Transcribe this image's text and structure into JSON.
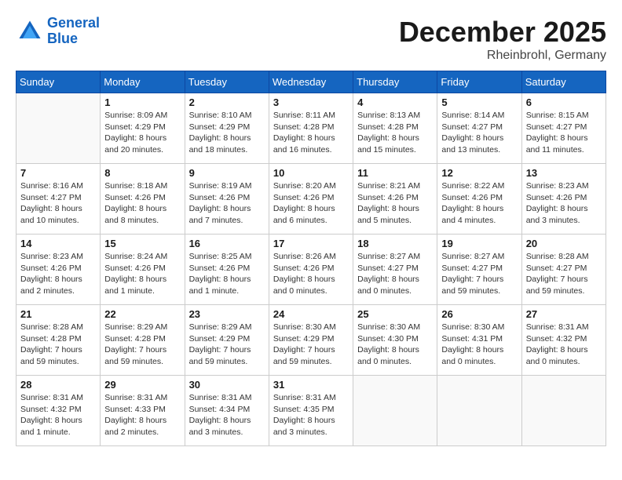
{
  "header": {
    "logo_line1": "General",
    "logo_line2": "Blue",
    "month": "December 2025",
    "location": "Rheinbrohl, Germany"
  },
  "weekdays": [
    "Sunday",
    "Monday",
    "Tuesday",
    "Wednesday",
    "Thursday",
    "Friday",
    "Saturday"
  ],
  "weeks": [
    [
      {
        "day": "",
        "info": ""
      },
      {
        "day": "1",
        "info": "Sunrise: 8:09 AM\nSunset: 4:29 PM\nDaylight: 8 hours\nand 20 minutes."
      },
      {
        "day": "2",
        "info": "Sunrise: 8:10 AM\nSunset: 4:29 PM\nDaylight: 8 hours\nand 18 minutes."
      },
      {
        "day": "3",
        "info": "Sunrise: 8:11 AM\nSunset: 4:28 PM\nDaylight: 8 hours\nand 16 minutes."
      },
      {
        "day": "4",
        "info": "Sunrise: 8:13 AM\nSunset: 4:28 PM\nDaylight: 8 hours\nand 15 minutes."
      },
      {
        "day": "5",
        "info": "Sunrise: 8:14 AM\nSunset: 4:27 PM\nDaylight: 8 hours\nand 13 minutes."
      },
      {
        "day": "6",
        "info": "Sunrise: 8:15 AM\nSunset: 4:27 PM\nDaylight: 8 hours\nand 11 minutes."
      }
    ],
    [
      {
        "day": "7",
        "info": "Sunrise: 8:16 AM\nSunset: 4:27 PM\nDaylight: 8 hours\nand 10 minutes."
      },
      {
        "day": "8",
        "info": "Sunrise: 8:18 AM\nSunset: 4:26 PM\nDaylight: 8 hours\nand 8 minutes."
      },
      {
        "day": "9",
        "info": "Sunrise: 8:19 AM\nSunset: 4:26 PM\nDaylight: 8 hours\nand 7 minutes."
      },
      {
        "day": "10",
        "info": "Sunrise: 8:20 AM\nSunset: 4:26 PM\nDaylight: 8 hours\nand 6 minutes."
      },
      {
        "day": "11",
        "info": "Sunrise: 8:21 AM\nSunset: 4:26 PM\nDaylight: 8 hours\nand 5 minutes."
      },
      {
        "day": "12",
        "info": "Sunrise: 8:22 AM\nSunset: 4:26 PM\nDaylight: 8 hours\nand 4 minutes."
      },
      {
        "day": "13",
        "info": "Sunrise: 8:23 AM\nSunset: 4:26 PM\nDaylight: 8 hours\nand 3 minutes."
      }
    ],
    [
      {
        "day": "14",
        "info": "Sunrise: 8:23 AM\nSunset: 4:26 PM\nDaylight: 8 hours\nand 2 minutes."
      },
      {
        "day": "15",
        "info": "Sunrise: 8:24 AM\nSunset: 4:26 PM\nDaylight: 8 hours\nand 1 minute."
      },
      {
        "day": "16",
        "info": "Sunrise: 8:25 AM\nSunset: 4:26 PM\nDaylight: 8 hours\nand 1 minute."
      },
      {
        "day": "17",
        "info": "Sunrise: 8:26 AM\nSunset: 4:26 PM\nDaylight: 8 hours\nand 0 minutes."
      },
      {
        "day": "18",
        "info": "Sunrise: 8:27 AM\nSunset: 4:27 PM\nDaylight: 8 hours\nand 0 minutes."
      },
      {
        "day": "19",
        "info": "Sunrise: 8:27 AM\nSunset: 4:27 PM\nDaylight: 7 hours\nand 59 minutes."
      },
      {
        "day": "20",
        "info": "Sunrise: 8:28 AM\nSunset: 4:27 PM\nDaylight: 7 hours\nand 59 minutes."
      }
    ],
    [
      {
        "day": "21",
        "info": "Sunrise: 8:28 AM\nSunset: 4:28 PM\nDaylight: 7 hours\nand 59 minutes."
      },
      {
        "day": "22",
        "info": "Sunrise: 8:29 AM\nSunset: 4:28 PM\nDaylight: 7 hours\nand 59 minutes."
      },
      {
        "day": "23",
        "info": "Sunrise: 8:29 AM\nSunset: 4:29 PM\nDaylight: 7 hours\nand 59 minutes."
      },
      {
        "day": "24",
        "info": "Sunrise: 8:30 AM\nSunset: 4:29 PM\nDaylight: 7 hours\nand 59 minutes."
      },
      {
        "day": "25",
        "info": "Sunrise: 8:30 AM\nSunset: 4:30 PM\nDaylight: 8 hours\nand 0 minutes."
      },
      {
        "day": "26",
        "info": "Sunrise: 8:30 AM\nSunset: 4:31 PM\nDaylight: 8 hours\nand 0 minutes."
      },
      {
        "day": "27",
        "info": "Sunrise: 8:31 AM\nSunset: 4:32 PM\nDaylight: 8 hours\nand 0 minutes."
      }
    ],
    [
      {
        "day": "28",
        "info": "Sunrise: 8:31 AM\nSunset: 4:32 PM\nDaylight: 8 hours\nand 1 minute."
      },
      {
        "day": "29",
        "info": "Sunrise: 8:31 AM\nSunset: 4:33 PM\nDaylight: 8 hours\nand 2 minutes."
      },
      {
        "day": "30",
        "info": "Sunrise: 8:31 AM\nSunset: 4:34 PM\nDaylight: 8 hours\nand 3 minutes."
      },
      {
        "day": "31",
        "info": "Sunrise: 8:31 AM\nSunset: 4:35 PM\nDaylight: 8 hours\nand 3 minutes."
      },
      {
        "day": "",
        "info": ""
      },
      {
        "day": "",
        "info": ""
      },
      {
        "day": "",
        "info": ""
      }
    ]
  ]
}
